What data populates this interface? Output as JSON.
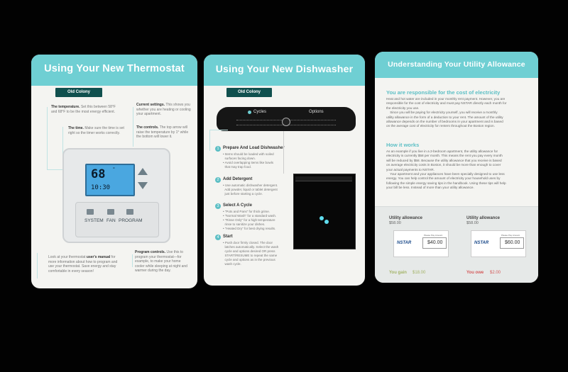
{
  "thermostat_card": {
    "title": "Using Your New Thermostat",
    "tag": "Old Colony",
    "temp_heading": "The temperature.",
    "temp_text": "Set this between 58°F and 68°F to be the most energy efficient.",
    "time_heading": "The time.",
    "time_text": "Make sure the time is set right so the timer works correctly.",
    "settings_heading": "Current settings.",
    "settings_text": "This shows you whether you are heating or cooling your apartment.",
    "controls_heading": "The controls.",
    "controls_text": "The top arrow will raise the temperature by 1° while the bottom will lower it.",
    "display_temp": "68",
    "display_time": "10:30",
    "buttons": [
      "SYSTEM",
      "FAN",
      "PROGRAM"
    ],
    "manual_text_a": "Look at your thermostat ",
    "manual_bold": "user's manual",
    "manual_text_b": " for more information about how to program and use your thermostat. Save energy and stay comfortable in every season!",
    "program_heading": "Program controls.",
    "program_text": "Use this to program your thermostat—for example, to make your home cooler while sleeping at night and warmer during the day."
  },
  "dishwasher_card": {
    "title": "Using Your New Dishwasher",
    "tag": "Old Colony",
    "panel_left": "Cycles",
    "panel_right": "Options",
    "steps": [
      {
        "num": "1",
        "title": "Prepare And Load Dishwasher",
        "lines": [
          "• Items should be loaded with soiled",
          "  surfaces facing down.",
          "• Avoid overlapping items like bowls",
          "  that may trap food."
        ]
      },
      {
        "num": "2",
        "title": "Add Detergent",
        "lines": [
          "• Use automatic dishwasher detergent.",
          "  Add powder, liquid or tablet detergent",
          "  just before starting a cycle."
        ]
      },
      {
        "num": "3",
        "title": "Select A Cycle",
        "lines": [
          "• \"Pots and Pans\" for thick grime.",
          "• \"Normal Wash\" for a standard wash.",
          "• \"Rinse Only\" for a high temperature",
          "  rinse to sanitize your dishes.",
          "• \"Heated Dry\" for best drying results."
        ]
      },
      {
        "num": "4",
        "title": "Start",
        "lines": [
          "• Push door firmly closed. The door",
          "  latches automatically. Select the wash",
          "  cycle and options desired OR press",
          "  START/RESUME to repeat the same",
          "  cycle and options as in the previous",
          "  wash cycle."
        ]
      }
    ]
  },
  "utility_card": {
    "title": "Understanding Your Utility Allowance",
    "section1_heading": "You are responsible for the cost of electricity",
    "section1_lines": [
      "Heat and hot water are included in your monthly rent payment. However, you are",
      "responsible for the cost of electricity and must pay NSTAR directly each month for",
      "the electricity you use.",
      "    Since you will be paying for electricity yourself, you will receive a monthly",
      "utility allowance in the form of a deduction to your rent. The amount of the utility",
      "allowance depends on the number of bedrooms in your apartment and is based",
      "on the average cost of electricity for renters throughout the Boston region."
    ],
    "section2_heading": "How it works",
    "section2_lines": [
      "As an example if you live in a 2-bedroom apartment, the utility allowance for",
      "electricity is currently $58 per month. This means the rent you pay every month",
      "will be reduced by $58. Because the utility allowance that you receive is based",
      "on average electricity costs in Boston, it should be more than enough to cover",
      "your actual payments to NSTAR.",
      "    Your apartment and your appliances have been specially designed to use less",
      "energy. You can help control the amount of electricity your household uses by",
      "following the simple energy saving tips in the handbook. Using these tips will help",
      "your bill be less. Instead of more than your utility allowance."
    ],
    "examples": [
      {
        "label": "Utility allowance",
        "allowance": "$58.00",
        "bill_label": "Please Pay Amount",
        "bill": "$40.00",
        "result_label": "You gain",
        "result": "$18.00"
      },
      {
        "label": "Utility allowance",
        "allowance": "$58.00",
        "bill_label": "Please Pay Amount",
        "bill": "$60.00",
        "result_label": "You owe",
        "result": "$2.00"
      }
    ],
    "brand": "NSTAR"
  }
}
